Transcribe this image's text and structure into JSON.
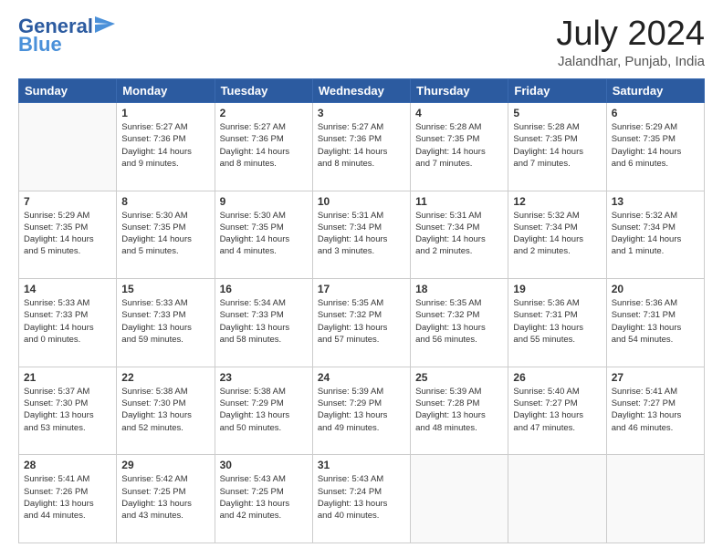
{
  "header": {
    "logo": {
      "general": "General",
      "blue": "Blue"
    },
    "title": "July 2024",
    "subtitle": "Jalandhar, Punjab, India"
  },
  "calendar": {
    "days_of_week": [
      "Sunday",
      "Monday",
      "Tuesday",
      "Wednesday",
      "Thursday",
      "Friday",
      "Saturday"
    ],
    "weeks": [
      [
        {
          "day": "",
          "info": ""
        },
        {
          "day": "1",
          "info": "Sunrise: 5:27 AM\nSunset: 7:36 PM\nDaylight: 14 hours\nand 9 minutes."
        },
        {
          "day": "2",
          "info": "Sunrise: 5:27 AM\nSunset: 7:36 PM\nDaylight: 14 hours\nand 8 minutes."
        },
        {
          "day": "3",
          "info": "Sunrise: 5:27 AM\nSunset: 7:36 PM\nDaylight: 14 hours\nand 8 minutes."
        },
        {
          "day": "4",
          "info": "Sunrise: 5:28 AM\nSunset: 7:35 PM\nDaylight: 14 hours\nand 7 minutes."
        },
        {
          "day": "5",
          "info": "Sunrise: 5:28 AM\nSunset: 7:35 PM\nDaylight: 14 hours\nand 7 minutes."
        },
        {
          "day": "6",
          "info": "Sunrise: 5:29 AM\nSunset: 7:35 PM\nDaylight: 14 hours\nand 6 minutes."
        }
      ],
      [
        {
          "day": "7",
          "info": "Sunrise: 5:29 AM\nSunset: 7:35 PM\nDaylight: 14 hours\nand 5 minutes."
        },
        {
          "day": "8",
          "info": "Sunrise: 5:30 AM\nSunset: 7:35 PM\nDaylight: 14 hours\nand 5 minutes."
        },
        {
          "day": "9",
          "info": "Sunrise: 5:30 AM\nSunset: 7:35 PM\nDaylight: 14 hours\nand 4 minutes."
        },
        {
          "day": "10",
          "info": "Sunrise: 5:31 AM\nSunset: 7:34 PM\nDaylight: 14 hours\nand 3 minutes."
        },
        {
          "day": "11",
          "info": "Sunrise: 5:31 AM\nSunset: 7:34 PM\nDaylight: 14 hours\nand 2 minutes."
        },
        {
          "day": "12",
          "info": "Sunrise: 5:32 AM\nSunset: 7:34 PM\nDaylight: 14 hours\nand 2 minutes."
        },
        {
          "day": "13",
          "info": "Sunrise: 5:32 AM\nSunset: 7:34 PM\nDaylight: 14 hours\nand 1 minute."
        }
      ],
      [
        {
          "day": "14",
          "info": "Sunrise: 5:33 AM\nSunset: 7:33 PM\nDaylight: 14 hours\nand 0 minutes."
        },
        {
          "day": "15",
          "info": "Sunrise: 5:33 AM\nSunset: 7:33 PM\nDaylight: 13 hours\nand 59 minutes."
        },
        {
          "day": "16",
          "info": "Sunrise: 5:34 AM\nSunset: 7:33 PM\nDaylight: 13 hours\nand 58 minutes."
        },
        {
          "day": "17",
          "info": "Sunrise: 5:35 AM\nSunset: 7:32 PM\nDaylight: 13 hours\nand 57 minutes."
        },
        {
          "day": "18",
          "info": "Sunrise: 5:35 AM\nSunset: 7:32 PM\nDaylight: 13 hours\nand 56 minutes."
        },
        {
          "day": "19",
          "info": "Sunrise: 5:36 AM\nSunset: 7:31 PM\nDaylight: 13 hours\nand 55 minutes."
        },
        {
          "day": "20",
          "info": "Sunrise: 5:36 AM\nSunset: 7:31 PM\nDaylight: 13 hours\nand 54 minutes."
        }
      ],
      [
        {
          "day": "21",
          "info": "Sunrise: 5:37 AM\nSunset: 7:30 PM\nDaylight: 13 hours\nand 53 minutes."
        },
        {
          "day": "22",
          "info": "Sunrise: 5:38 AM\nSunset: 7:30 PM\nDaylight: 13 hours\nand 52 minutes."
        },
        {
          "day": "23",
          "info": "Sunrise: 5:38 AM\nSunset: 7:29 PM\nDaylight: 13 hours\nand 50 minutes."
        },
        {
          "day": "24",
          "info": "Sunrise: 5:39 AM\nSunset: 7:29 PM\nDaylight: 13 hours\nand 49 minutes."
        },
        {
          "day": "25",
          "info": "Sunrise: 5:39 AM\nSunset: 7:28 PM\nDaylight: 13 hours\nand 48 minutes."
        },
        {
          "day": "26",
          "info": "Sunrise: 5:40 AM\nSunset: 7:27 PM\nDaylight: 13 hours\nand 47 minutes."
        },
        {
          "day": "27",
          "info": "Sunrise: 5:41 AM\nSunset: 7:27 PM\nDaylight: 13 hours\nand 46 minutes."
        }
      ],
      [
        {
          "day": "28",
          "info": "Sunrise: 5:41 AM\nSunset: 7:26 PM\nDaylight: 13 hours\nand 44 minutes."
        },
        {
          "day": "29",
          "info": "Sunrise: 5:42 AM\nSunset: 7:25 PM\nDaylight: 13 hours\nand 43 minutes."
        },
        {
          "day": "30",
          "info": "Sunrise: 5:43 AM\nSunset: 7:25 PM\nDaylight: 13 hours\nand 42 minutes."
        },
        {
          "day": "31",
          "info": "Sunrise: 5:43 AM\nSunset: 7:24 PM\nDaylight: 13 hours\nand 40 minutes."
        },
        {
          "day": "",
          "info": ""
        },
        {
          "day": "",
          "info": ""
        },
        {
          "day": "",
          "info": ""
        }
      ]
    ]
  }
}
